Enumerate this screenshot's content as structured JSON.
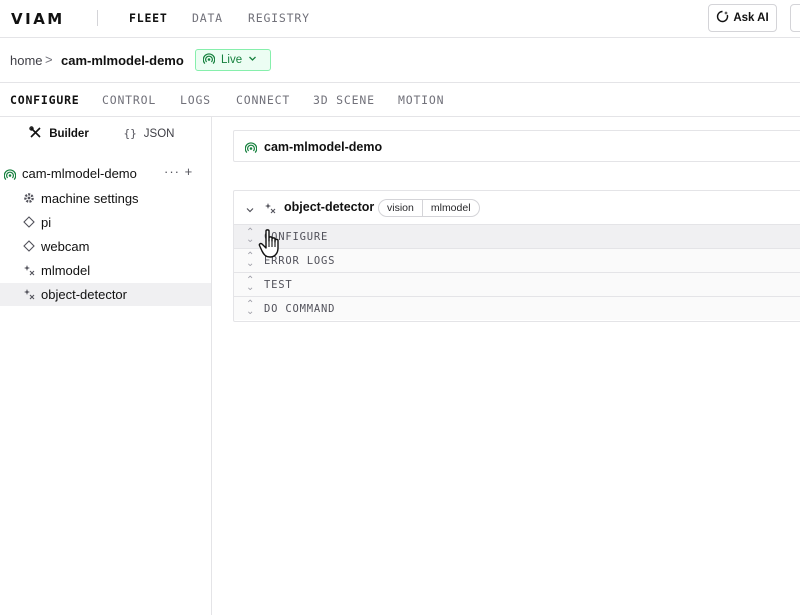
{
  "nav": {
    "logo": "VIAM",
    "links": [
      "FLEET",
      "DATA",
      "REGISTRY"
    ],
    "ask_label": "Ask AI"
  },
  "breadcrumb": {
    "home": "home",
    "separator": ">",
    "machine": "cam-mlmodel-demo",
    "status": "Live"
  },
  "tabs": [
    "CONFIGURE",
    "CONTROL",
    "LOGS",
    "CONNECT",
    "3D SCENE",
    "MOTION"
  ],
  "sidebar": {
    "builder_label": "Builder",
    "json_label": "JSON",
    "json_icon": "{}",
    "root_label": "cam-mlmodel-demo",
    "root_actions": "··· +",
    "items": [
      {
        "label": "machine settings",
        "icon": "gear-icon"
      },
      {
        "label": "pi",
        "icon": "diamond-icon"
      },
      {
        "label": "webcam",
        "icon": "diamond-icon"
      },
      {
        "label": "mlmodel",
        "icon": "sparkle-icon"
      },
      {
        "label": "object-detector",
        "icon": "sparkle-icon",
        "selected": true
      }
    ]
  },
  "main": {
    "machine_title": "cam-mlmodel-demo",
    "resource": {
      "title": "object-detector",
      "tags": [
        "vision",
        "mlmodel"
      ],
      "sections": [
        "CONFIGURE",
        "ERROR LOGS",
        "TEST",
        "DO COMMAND"
      ]
    }
  },
  "colors": {
    "live_green": "#15803d",
    "live_bg": "#ecfdf3",
    "border": "#e4e4e7"
  }
}
